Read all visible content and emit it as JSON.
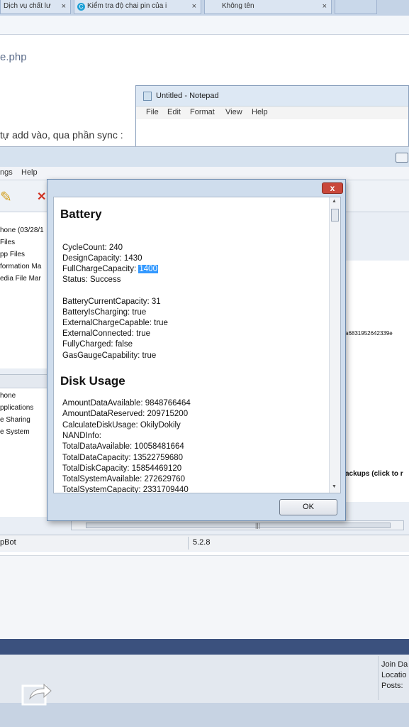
{
  "browser": {
    "tabs": [
      {
        "label": "Dịch vụ chất lư",
        "close": "×"
      },
      {
        "label": "Kiểm tra độ chai pin của i",
        "close": "×"
      },
      {
        "label": "Không tên",
        "close": "×"
      }
    ]
  },
  "web": {
    "link_text": "e.php",
    "body_text": "tự add vào, qua phần sync :"
  },
  "notepad": {
    "title": "Untitled - Notepad",
    "menu": [
      "File",
      "Edit",
      "Format",
      "View",
      "Help"
    ]
  },
  "app": {
    "menu": [
      "ngs",
      "Help"
    ],
    "tree_top": [
      "hone (03/28/1",
      "Files",
      "pp Files",
      "formation Ma",
      "edia File Mar"
    ],
    "tree_bottom": [
      "hone",
      "pplications",
      "e Sharing",
      "e System"
    ],
    "right_hash": "a6831952642339e",
    "right_backups": "ackups (click to r",
    "status_left": "pBot",
    "status_version": "5.2.8",
    "scroll_grip": "|||"
  },
  "dialog": {
    "close_glyph": "x",
    "battery_heading": "Battery",
    "battery": {
      "cycle_count": "CycleCount: 240",
      "design_capacity": "DesignCapacity: 1430",
      "full_charge_label": "FullChargeCapacity: ",
      "full_charge_value": "1400",
      "status": "Status: Success",
      "current_capacity": "BatteryCurrentCapacity: 31",
      "is_charging": "BatteryIsCharging: true",
      "external_charge_capable": "ExternalChargeCapable: true",
      "external_connected": "ExternalConnected: true",
      "fully_charged": "FullyCharged: false",
      "gas_gauge": "GasGaugeCapability: true"
    },
    "disk_heading": "Disk Usage",
    "disk": {
      "amount_available": "AmountDataAvailable: 9848766464",
      "amount_reserved": "AmountDataReserved: 209715200",
      "calculate_usage": "CalculateDiskUsage: OkilyDokily",
      "nand_info": "NANDInfo:",
      "total_data_available": "TotalDataAvailable: 10058481664",
      "total_data_capacity": "TotalDataCapacity: 13522759680",
      "total_disk_capacity": "TotalDiskCapacity: 15854469120",
      "total_system_available": "TotalSystemAvailable: 272629760",
      "total_system_capacity": "TotalSystemCapacity: 2331709440"
    },
    "ok_label": "OK"
  },
  "profile": {
    "join_date": "Join Da",
    "location": "Locatio",
    "posts": "Posts: "
  },
  "colors": {
    "selection": "#3399ff",
    "navy_band": "#3b517e",
    "close_red": "#c9473a"
  },
  "icons": [
    "globe-icon",
    "notepad-icon",
    "close-icon",
    "share-icon",
    "scroll-up-icon",
    "scroll-down-icon"
  ]
}
